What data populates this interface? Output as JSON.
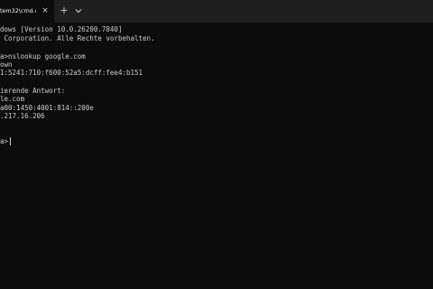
{
  "tab": {
    "title": "tem32\\cmd.e",
    "close_glyph": "×"
  },
  "toolbar": {
    "new_tab_glyph": "+",
    "dropdown_icon": "chevron-down-icon"
  },
  "console": {
    "lines": [
      "dows [Version 10.0.26200.7840]",
      " Corporation. Alle Rechte vorbehalten.",
      "",
      "a>nslookup google.com",
      "own",
      "1:5241:710:f600:52a5:dcff:fee4:b151",
      "",
      "ierende Antwort:",
      "le.com",
      "a00:1450:4001:814::200e",
      ".217.16.206",
      "",
      "a>"
    ]
  },
  "colors": {
    "console_bg": "#0c0c0c",
    "titlebar_bg": "#1f1f1f",
    "text": "#cccccc"
  }
}
